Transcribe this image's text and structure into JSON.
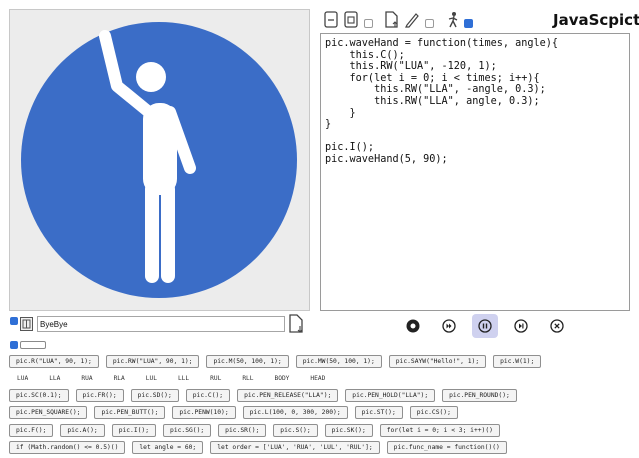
{
  "app": {
    "title": "JavaScpict"
  },
  "toolbar": {
    "buttons": [
      {
        "icon": "new-file-icon"
      },
      {
        "icon": "open-file-icon"
      },
      {
        "icon": "export-icon"
      },
      {
        "icon": "pencil-icon"
      },
      {
        "icon": "walking-person-icon"
      }
    ],
    "checkboxes": [
      false,
      false,
      true
    ]
  },
  "editor": {
    "code": "pic.waveHand = function(times, angle){\n    this.C();\n    this.RW(\"LUA\", -120, 1);\n    for(let i = 0; i < times; i++){\n        this.RW(\"LLA\", -angle, 0.3);\n        this.RW(\"LLA\", angle, 0.3);\n    }\n}\n\npic.I();\npic.waveHand(5, 90);"
  },
  "name_field": {
    "value": "ByeBye"
  },
  "colors": {
    "circle": "#3b6dc7",
    "figure": "#ffffff",
    "accent": "#2f6fd6",
    "pause_bg": "#cfd1ef"
  },
  "playback": [
    {
      "name": "record-button",
      "icon": "record-icon"
    },
    {
      "name": "fast-forward-button",
      "icon": "fast-forward-icon"
    },
    {
      "name": "pause-button",
      "icon": "pause-icon",
      "active": true
    },
    {
      "name": "step-button",
      "icon": "step-icon"
    },
    {
      "name": "stop-button",
      "icon": "close-circle-icon"
    }
  ],
  "commands": {
    "row1": [
      "pic.R(\"LUA\", 90, 1);",
      "pic.RW(\"LUA\", 90, 1);",
      "pic.M(50, 100, 1);",
      "pic.MW(50, 100, 1);",
      "pic.SAYW(\"Hello!\", 1);",
      "pic.W(1);"
    ],
    "labels": [
      "LUA",
      "LLA",
      "RUA",
      "RLA",
      "LUL",
      "LLL",
      "RUL",
      "RLL",
      "BODY",
      "HEAD"
    ],
    "row2": [
      "pic.SC(0.1);",
      "pic.FR();",
      "pic.SD();",
      "pic.C();",
      "pic.PEN_RELEASE(\"LLA\");",
      "pic.PEN_HOLD(\"LLA\");",
      "pic.PEN_ROUND();"
    ],
    "row3": [
      "pic.PEN_SQUARE();",
      "pic.PEN_BUTT();",
      "pic.PENW(10);",
      "pic.L(100, 0, 300, 200);",
      "pic.ST();",
      "pic.CS();"
    ],
    "row4": [
      "pic.F();",
      "pic.A();",
      "pic.I();",
      "pic.SG();",
      "pic.SR();",
      "pic.S();",
      "pic.SK();",
      "for(let i = 0; i < 3; i++)()"
    ],
    "row5": [
      "if (Math.random() <= 0.5)()",
      "let angle = 60;",
      "let order = ['LUA', 'RUA', 'LUL', 'RUL'];",
      "pic.func_name = function()()"
    ]
  }
}
